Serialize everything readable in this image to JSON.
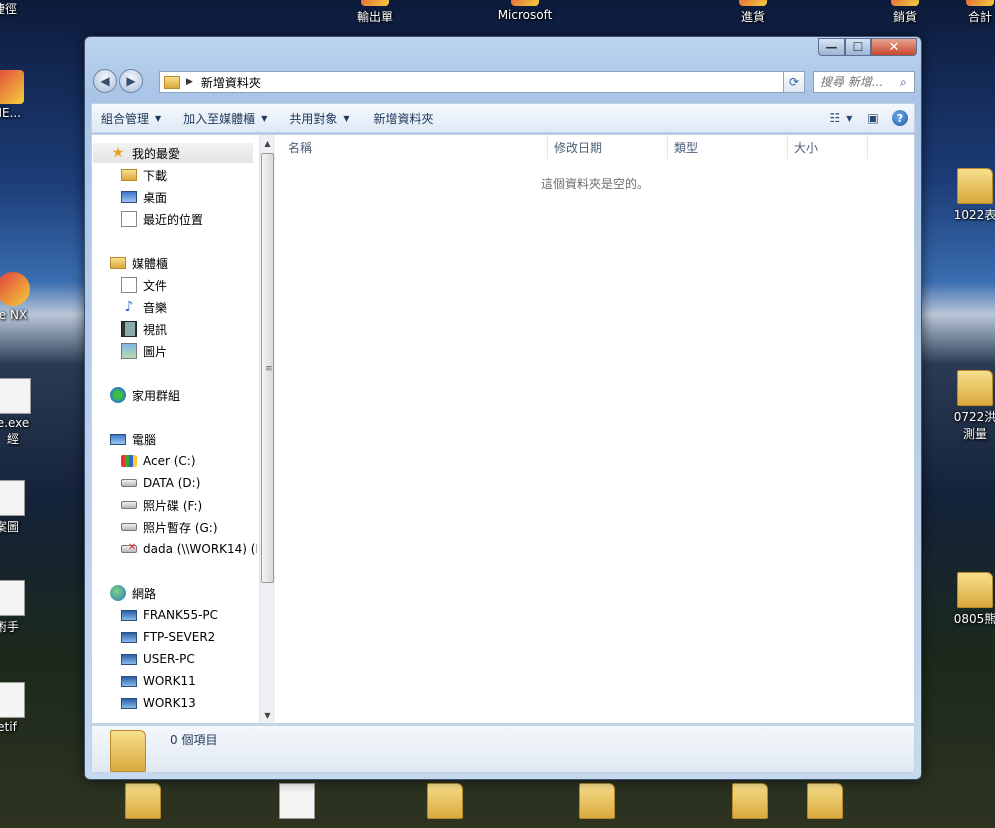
{
  "desktop": {
    "icons": [
      {
        "label": "捷徑"
      },
      {
        "label": "輸出單"
      },
      {
        "label": "Microsoft"
      },
      {
        "label": "進貨"
      },
      {
        "label": "銷貨"
      },
      {
        "label": "合計"
      },
      {
        "label": "HE..."
      },
      {
        "label": "1022表"
      },
      {
        "label": "e NX"
      },
      {
        "label": "e.exe"
      },
      {
        "label": "經"
      },
      {
        "label": "0722洪"
      },
      {
        "label": "測量"
      },
      {
        "label": "案圖"
      },
      {
        "label": "術手"
      },
      {
        "label": "0805熊"
      },
      {
        "label": "etif"
      }
    ]
  },
  "window": {
    "caption": {
      "minimize": "—",
      "maximize": "☐",
      "close": "✕"
    },
    "address": {
      "crumb": "新增資料夾"
    },
    "search": {
      "placeholder": "搜尋 新增..."
    },
    "toolbar": {
      "organize": "組合管理",
      "add_to_library": "加入至媒體櫃",
      "share_with": "共用對象",
      "new_folder": "新增資料夾"
    },
    "nav": {
      "favorites": {
        "label": "我的最愛",
        "items": [
          "下載",
          "桌面",
          "最近的位置"
        ]
      },
      "libraries": {
        "label": "媒體櫃",
        "items": [
          "文件",
          "音樂",
          "視訊",
          "圖片"
        ]
      },
      "homegroup": {
        "label": "家用群組"
      },
      "computer": {
        "label": "電腦",
        "items": [
          "Acer (C:)",
          "DATA (D:)",
          "照片碟 (F:)",
          "照片暫存 (G:)",
          "dada (\\\\WORK14) (I"
        ]
      },
      "network": {
        "label": "網路",
        "items": [
          "FRANK55-PC",
          "FTP-SEVER2",
          "USER-PC",
          "WORK11",
          "WORK13"
        ]
      }
    },
    "columns": [
      "名稱",
      "修改日期",
      "類型",
      "大小"
    ],
    "empty_message": "這個資料夾是空的。",
    "details": {
      "count": "0 個項目"
    }
  }
}
